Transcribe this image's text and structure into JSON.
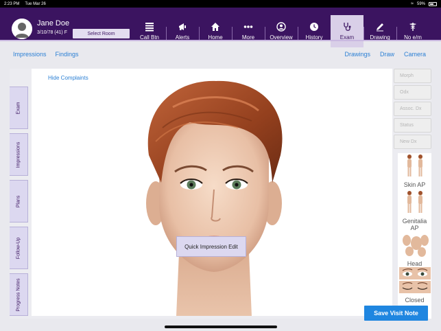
{
  "status_bar": {
    "time": "2:23 PM",
    "date": "Tue Mar 26",
    "battery": "59%",
    "battery_level": 0.59
  },
  "patient": {
    "name": "Jane Doe",
    "dob_line": "3/10/78 (41) F",
    "select_room_label": "Select Room"
  },
  "nav": {
    "call_btn": "Call Btn",
    "alerts": "Alerts",
    "home": "Home",
    "more": "More",
    "overview": "Overview",
    "history": "History",
    "exam": "Exam",
    "drawing": "Drawing",
    "no_em": "No e/m"
  },
  "subnav": {
    "impressions": "Impressions",
    "findings": "Findings",
    "drawings": "Drawings",
    "draw": "Draw",
    "camera": "Camera"
  },
  "side_tabs": {
    "exam": "Exam",
    "impressions": "Impressions",
    "plans": "Plans",
    "follow_up": "Follow-Up",
    "progress_notes": "Progress Notes"
  },
  "stage": {
    "hide_complaints": "Hide Complaints",
    "quick_impression_edit": "Quick Impression Edit"
  },
  "right_panel": {
    "morph": "Morph",
    "odx": "Odx",
    "assoc_dx": "Assoc. Dx",
    "status": "Status",
    "new_dx": "New Dx",
    "skin_ap": "Skin AP",
    "genitalia_ap": "Genitalia AP",
    "head": "Head",
    "closed": "Closed"
  },
  "actions": {
    "save_visit_note": "Save Visit Note"
  },
  "colors": {
    "header": "#3b1460",
    "accent": "#2a7fd4",
    "save": "#1f86e0"
  }
}
